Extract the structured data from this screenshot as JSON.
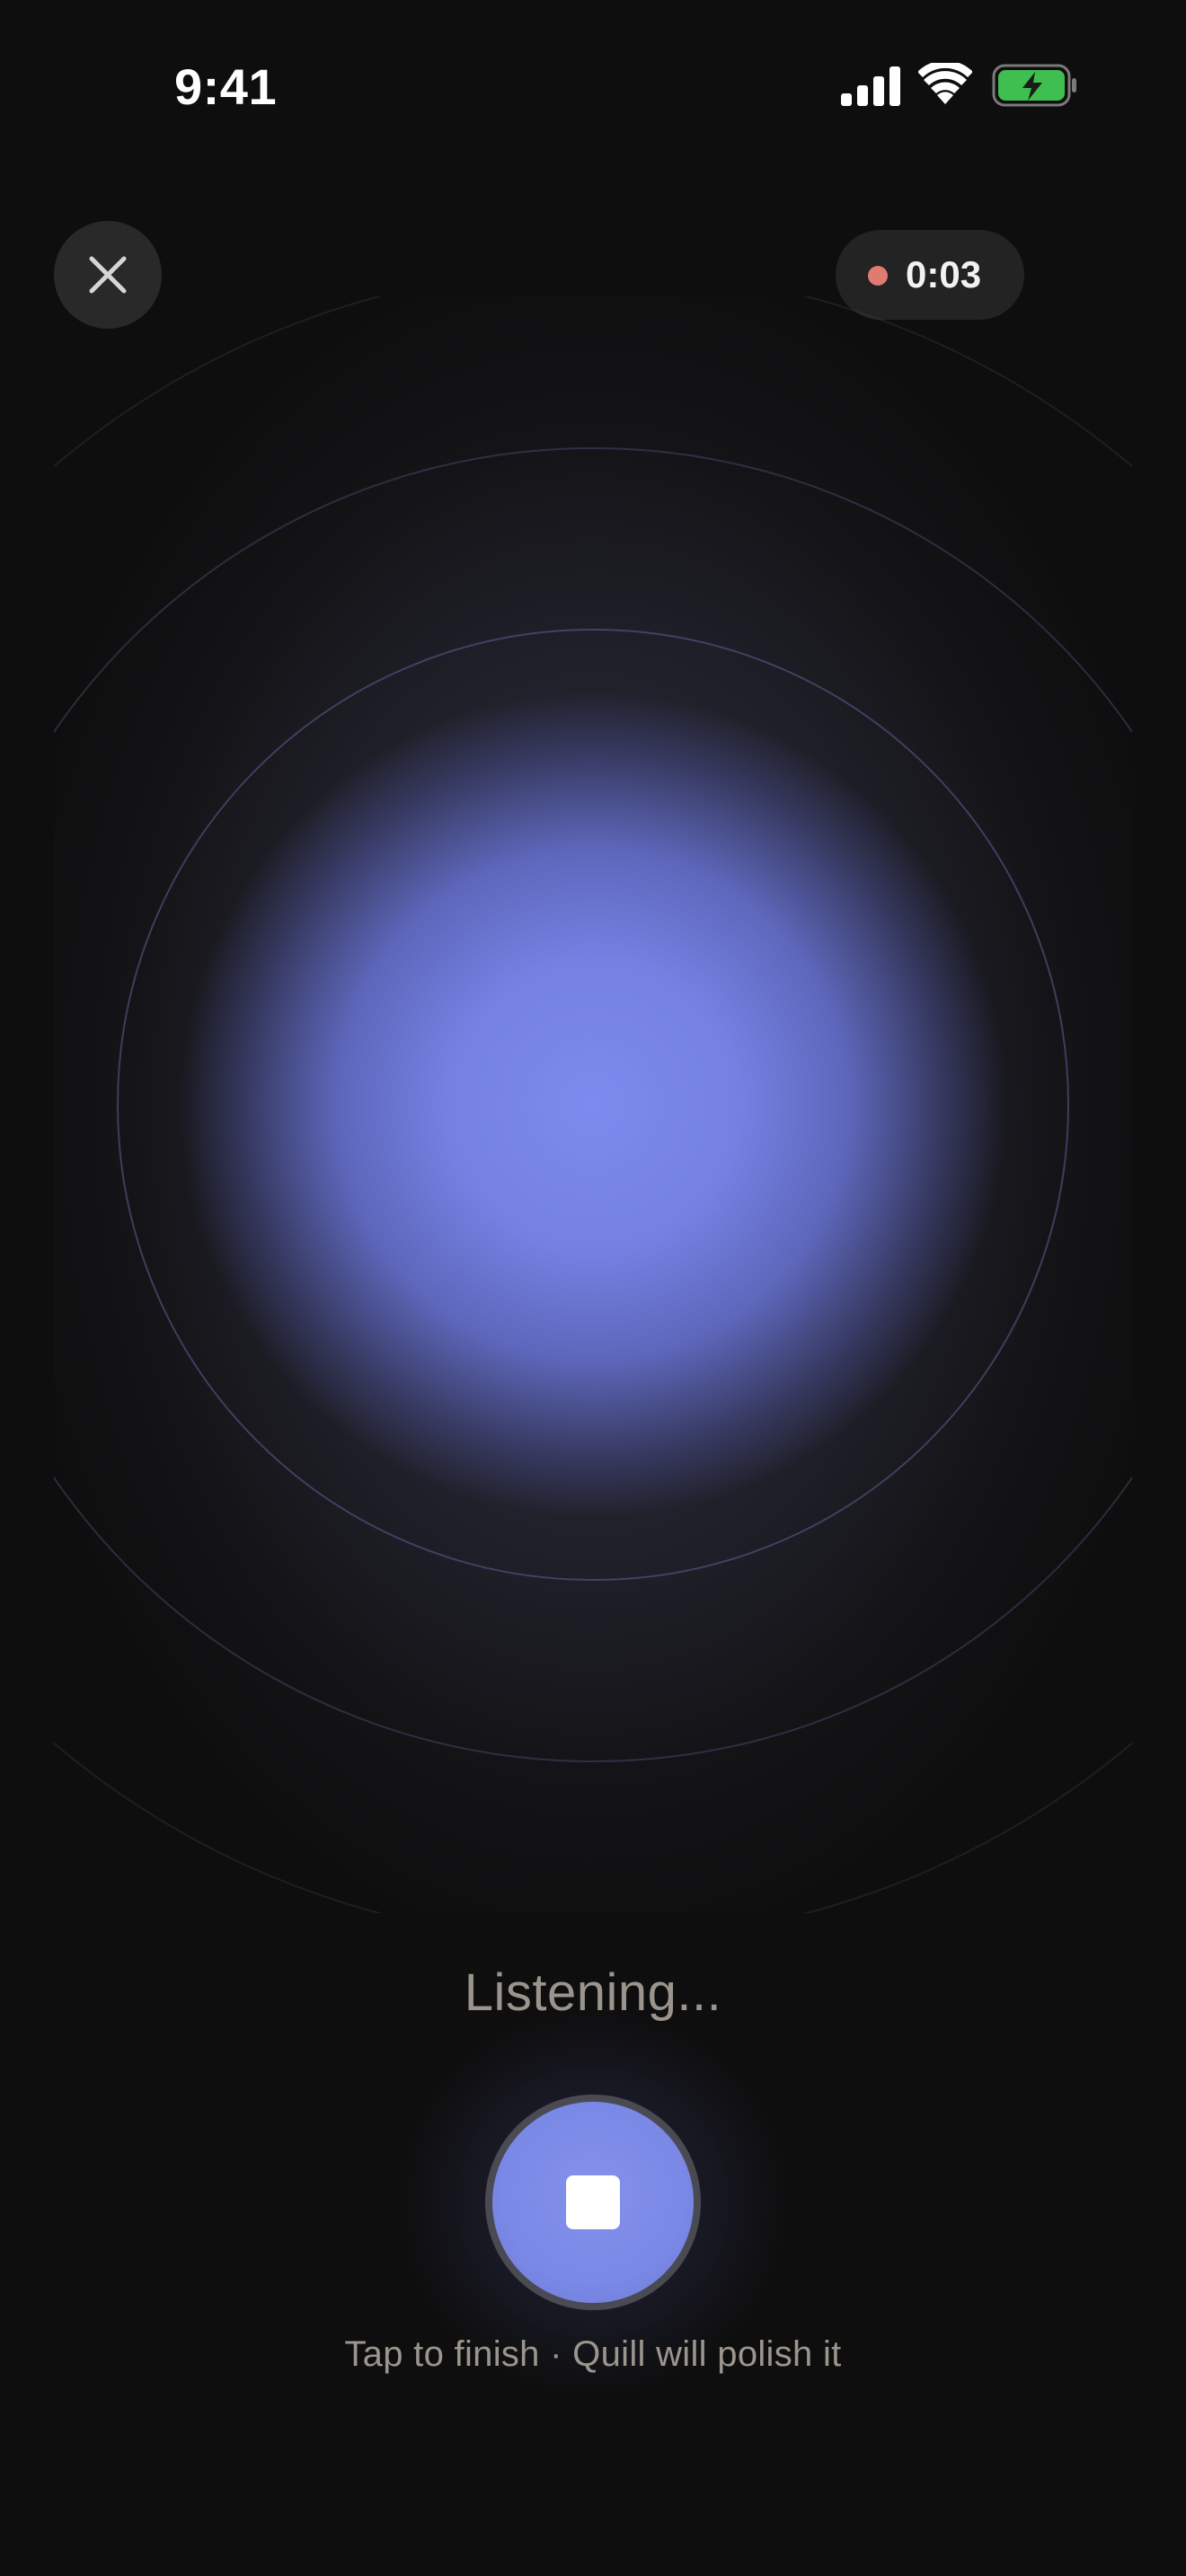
{
  "status_bar": {
    "time": "9:41",
    "icons": [
      "signal-icon",
      "wifi-icon",
      "battery-charging-icon"
    ],
    "battery_color": "#3fbf4f"
  },
  "header": {
    "close_icon": "close-icon",
    "timer": {
      "indicator_color": "#e07b72",
      "elapsed": "0:03"
    }
  },
  "visualizer": {
    "orb_color": "#7d8bee",
    "ring_color": "#5f5e96"
  },
  "status_text": "Listening...",
  "stop_button": {
    "icon": "stop-icon",
    "color": "#7a88e6"
  },
  "hint": "Tap to finish · Quill will polish it"
}
